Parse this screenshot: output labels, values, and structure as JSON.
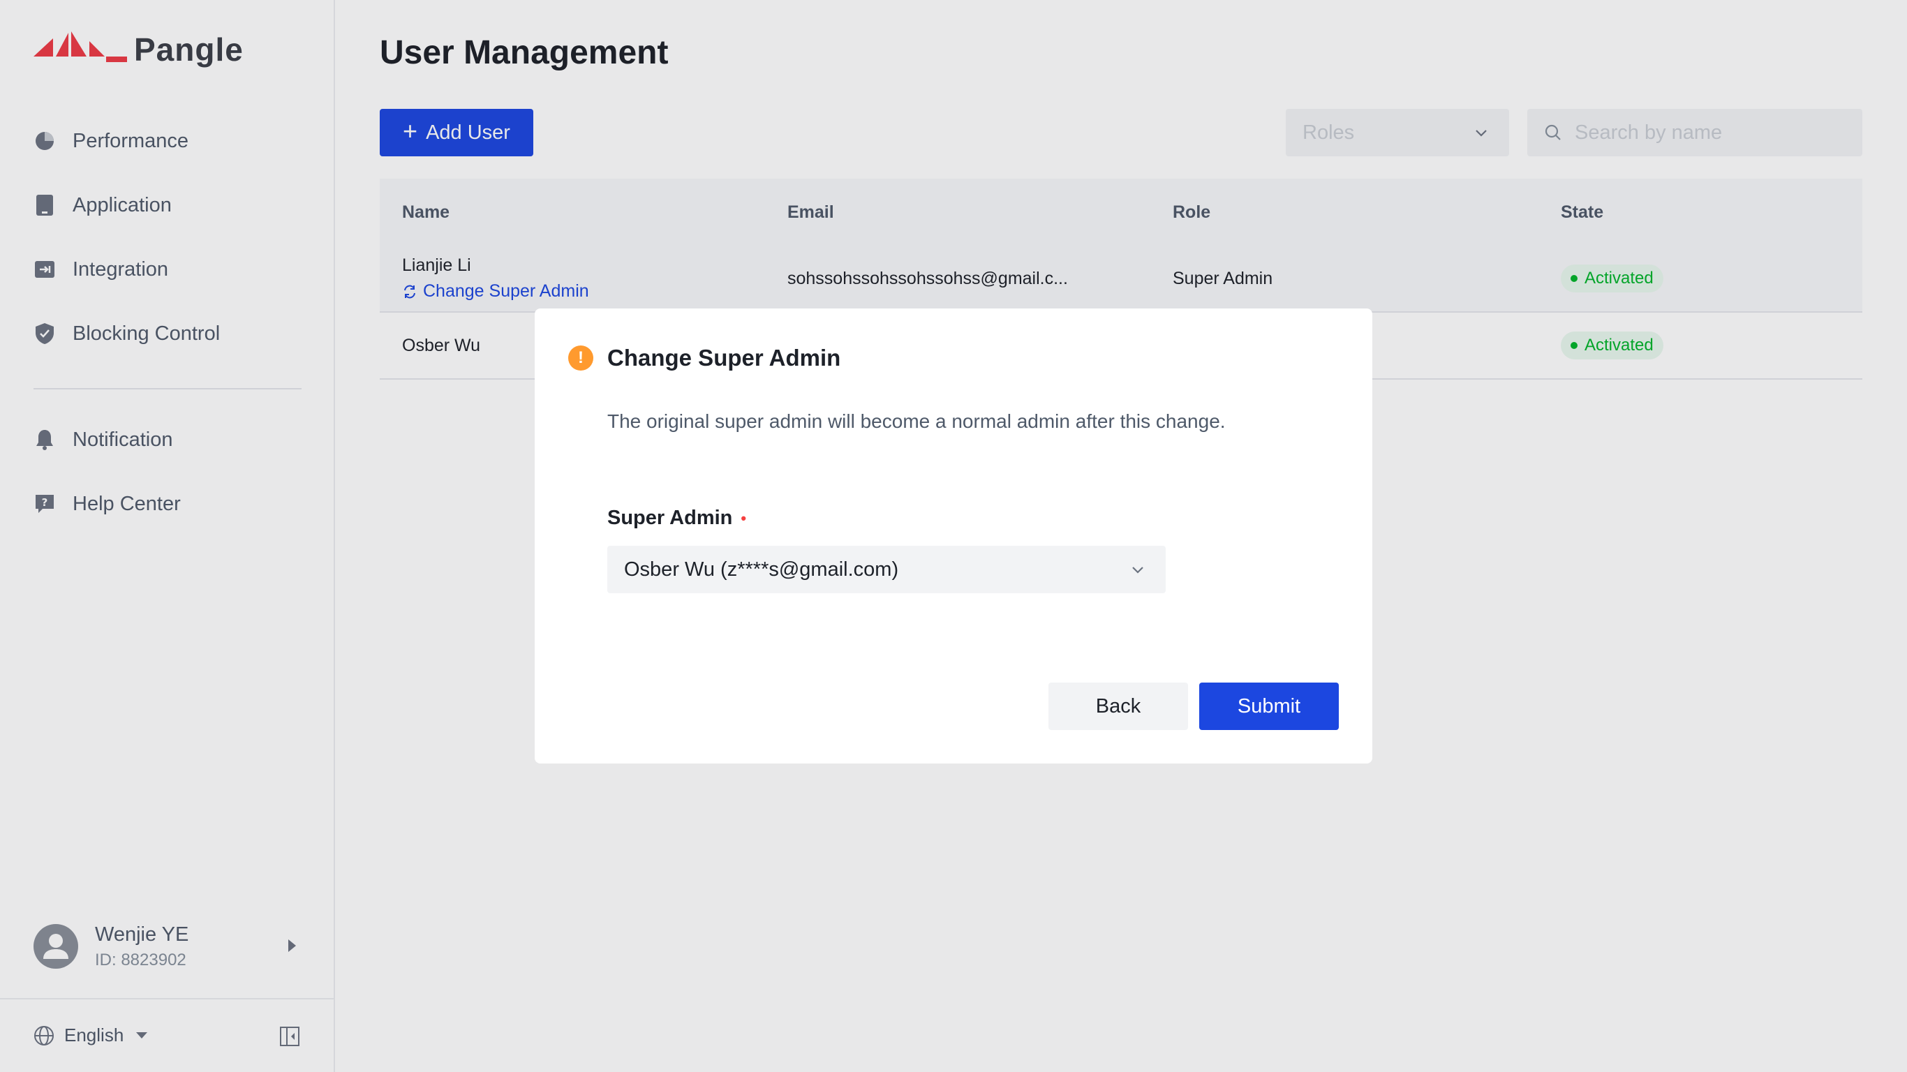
{
  "brand": {
    "name": "Pangle",
    "accent": "#ee3a46"
  },
  "sidebar": {
    "items": [
      {
        "label": "Performance",
        "icon": "pie-chart-icon"
      },
      {
        "label": "Application",
        "icon": "app-icon"
      },
      {
        "label": "Integration",
        "icon": "integration-icon"
      },
      {
        "label": "Blocking Control",
        "icon": "shield-icon"
      }
    ],
    "secondary_items": [
      {
        "label": "Notification",
        "icon": "bell-icon"
      },
      {
        "label": "Help Center",
        "icon": "help-icon"
      }
    ],
    "user": {
      "name": "Wenjie YE",
      "id": "ID: 8823902"
    },
    "language": "English"
  },
  "main": {
    "title": "User Management",
    "add_user_label": "Add User",
    "roles_placeholder": "Roles",
    "search_placeholder": "Search by name",
    "table": {
      "columns": [
        "Name",
        "Email",
        "Role",
        "State"
      ],
      "rows": [
        {
          "name": "Lianjie Li",
          "action": "Change Super Admin",
          "email": "sohssohssohssohssohss@gmail.c...",
          "role": "Super Admin",
          "state": "Activated"
        },
        {
          "name": "Osber Wu",
          "email": "",
          "role": "",
          "state": "Activated"
        }
      ]
    }
  },
  "modal": {
    "title": "Change Super Admin",
    "description": "The original super admin will become a normal admin after this change.",
    "field_label": "Super Admin",
    "required_mark": "•",
    "selected_value": "Osber Wu (z****s@gmail.com)",
    "back_label": "Back",
    "submit_label": "Submit"
  },
  "colors": {
    "primary": "#1c47e0",
    "success": "#00b42a",
    "warning": "#ff9a2e"
  }
}
